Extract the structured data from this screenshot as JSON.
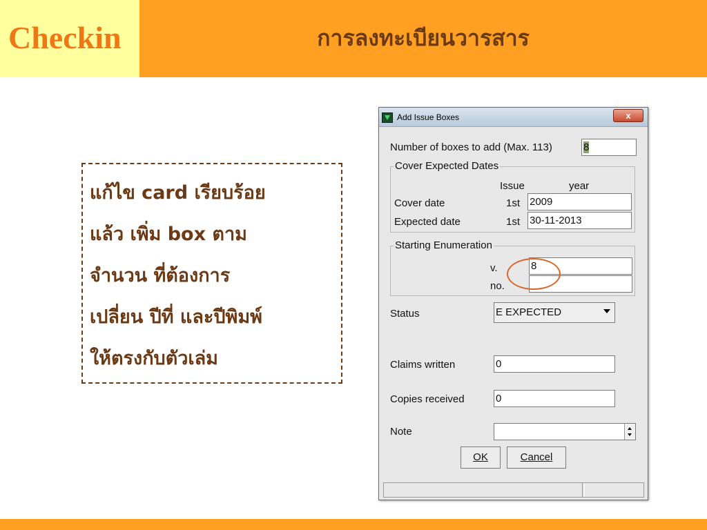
{
  "header": {
    "logo_text": "Checkin",
    "title": "การลงทะเบียนวารสาร"
  },
  "note_box": {
    "lines": [
      "แก้ไข card เรียบร้อย",
      "แล้ว  เพิ่ม box ตาม",
      "จำนวน ที่ต้องการ",
      "เปลี่ยน ปีที่ และปีพิมพ์",
      "ให้ตรงกับตัวเล่ม"
    ]
  },
  "dialog": {
    "title": "Add Issue Boxes",
    "close_label": "x",
    "num_boxes_label": "Number of boxes to add (Max.   113)",
    "num_boxes_value": "8",
    "cover_group": {
      "title": "Cover  Expected Dates",
      "col_issue": "Issue",
      "col_year": "year",
      "cover_date_label": "Cover date",
      "cover_date_issue": "1st",
      "cover_date_value": "2009",
      "expected_date_label": "Expected date",
      "expected_date_issue": "1st",
      "expected_date_value": "30-11-2013"
    },
    "enum_group": {
      "title": "Starting Enumeration",
      "v_label": "v.",
      "v_value": "8",
      "no_label": "no.",
      "no_value": ""
    },
    "status_label": "Status",
    "status_value": "E EXPECTED",
    "claims_label": "Claims written",
    "claims_value": "0",
    "copies_label": "Copies received",
    "copies_value": "0",
    "note_label": "Note",
    "note_value": "",
    "ok_label": "OK",
    "cancel_label": "Cancel"
  },
  "colors": {
    "header_orange": "#FFA023",
    "header_yellow": "#FFFFA0",
    "logo_orange": "#F07814",
    "text_brown": "#6B3A14",
    "highlight_circle": "#D9662B"
  }
}
